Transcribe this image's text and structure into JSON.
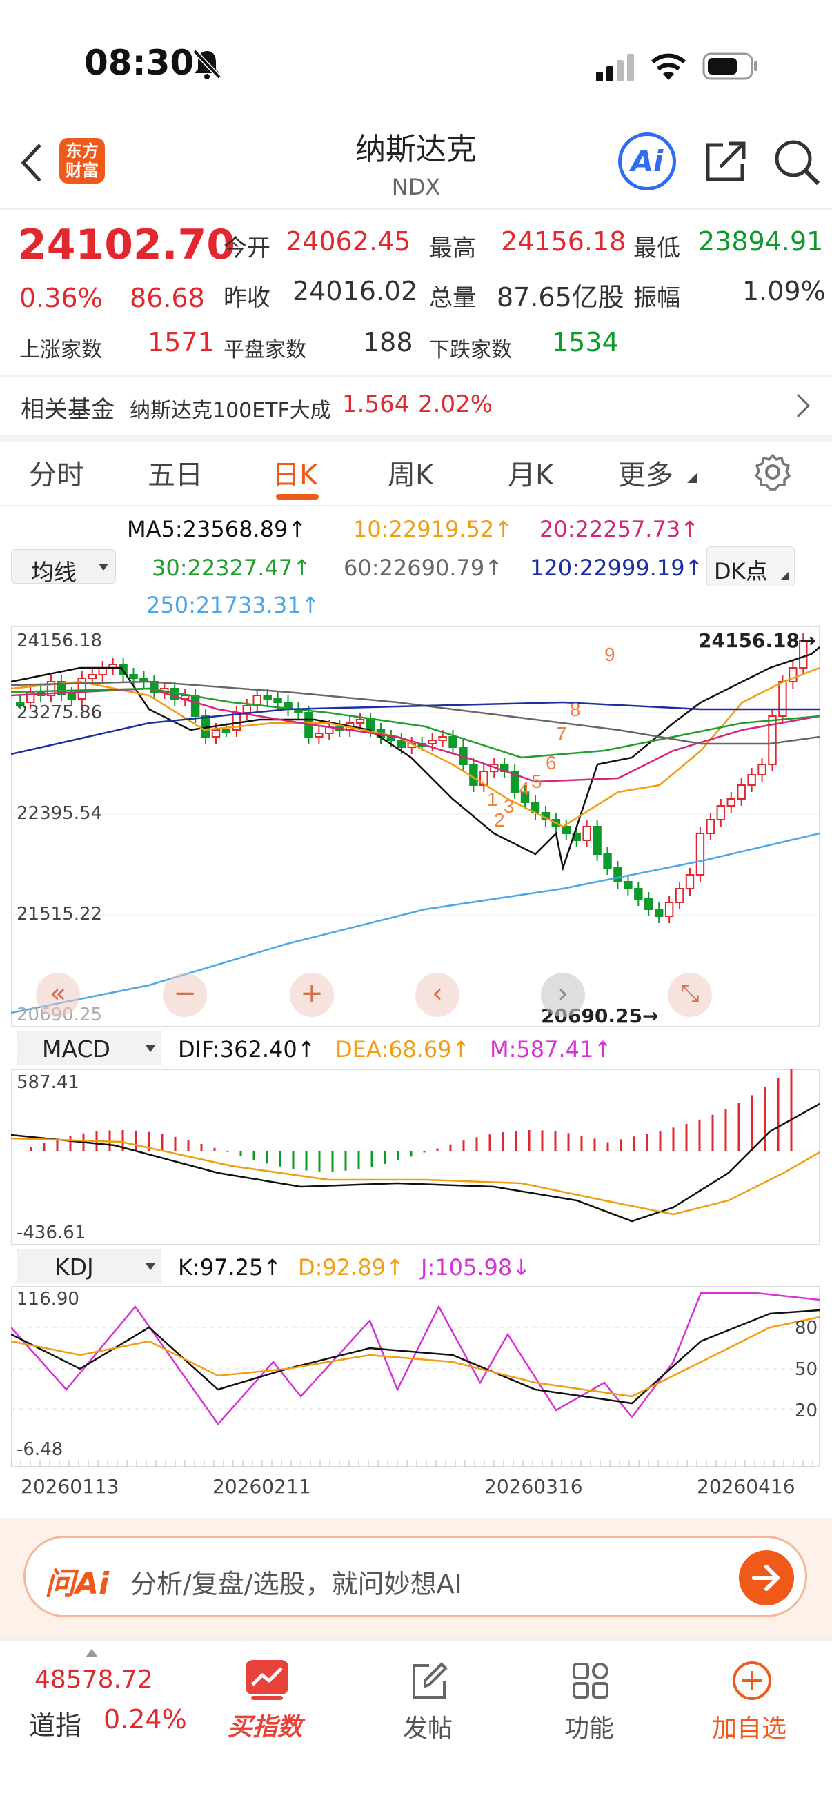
{
  "status_bar": {
    "time": "08:30"
  },
  "header": {
    "title": "纳斯达克",
    "code": "NDX",
    "logo_text_1": "东方",
    "logo_text_2": "财富",
    "ai_label": "Ai"
  },
  "quote": {
    "price": "24102.70",
    "change_pct": "0.36%",
    "change": "86.68",
    "open_label": "今开",
    "open": "24062.45",
    "high_label": "最高",
    "high": "24156.18",
    "low_label": "最低",
    "low": "23894.91",
    "prev_label": "昨收",
    "prev": "24016.02",
    "volume_label": "总量",
    "volume": "87.65亿股",
    "amp_label": "振幅",
    "amp": "1.09%",
    "up_label": "上涨家数",
    "up": "1571",
    "flat_label": "平盘家数",
    "flat": "188",
    "down_label": "下跌家数",
    "down": "1534"
  },
  "fund": {
    "label": "相关基金",
    "name": "纳斯达克100ETF大成",
    "price": "1.564",
    "pct": "2.02%"
  },
  "tabs": [
    "分时",
    "五日",
    "日K",
    "周K",
    "月K",
    "更多"
  ],
  "active_tab": "日K",
  "ma": {
    "selector": "均线",
    "ma5": "MA5:23568.89↑",
    "ma10": "10:22919.52↑",
    "ma20": "20:22257.73↑",
    "ma30": "30:22327.47↑",
    "ma60": "60:22690.79↑",
    "ma120": "120:22999.19↑",
    "ma250": "250:21733.31↑",
    "dk": "DK点"
  },
  "kline": {
    "y_labels": [
      "24156.18",
      "23275.86",
      "22395.54",
      "21515.22",
      "20690.25"
    ],
    "max_mark": "24156.18",
    "min_mark": "20690.25",
    "nine_labels_up": [
      "1",
      "2",
      "3",
      "4",
      "5",
      "6",
      "7",
      "8",
      "9"
    ],
    "colors": {
      "up": "#e0282e",
      "down": "#0c9a2a",
      "ma5": "#111111",
      "ma10": "#f39c12",
      "ma20": "#d6247a",
      "ma30": "#1f9e2c",
      "ma60": "#666666",
      "ma120": "#1d2fa0",
      "ma250": "#4aa8e8"
    }
  },
  "macd": {
    "selector": "MACD",
    "dif": "DIF:362.40↑",
    "dea": "DEA:68.69↑",
    "m": "M:587.41↑",
    "top": "587.41",
    "bottom": "-436.61"
  },
  "kdj": {
    "selector": "KDJ",
    "k": "K:97.25↑",
    "d": "D:92.89↑",
    "j": "J:105.98↓",
    "top": "116.90",
    "bottom": "-6.48",
    "levels": [
      "80",
      "50",
      "20"
    ]
  },
  "dates": [
    "20260113",
    "20260211",
    "20260316",
    "20260416"
  ],
  "ai_bar": {
    "logo": "问Ai",
    "placeholder": "分析/复盘/选股，就问妙想AI"
  },
  "bottom": {
    "index_value": "48578.72",
    "index_name": "道指",
    "index_pct": "0.24%",
    "items": [
      "买指数",
      "发帖",
      "功能",
      "加自选"
    ]
  }
}
